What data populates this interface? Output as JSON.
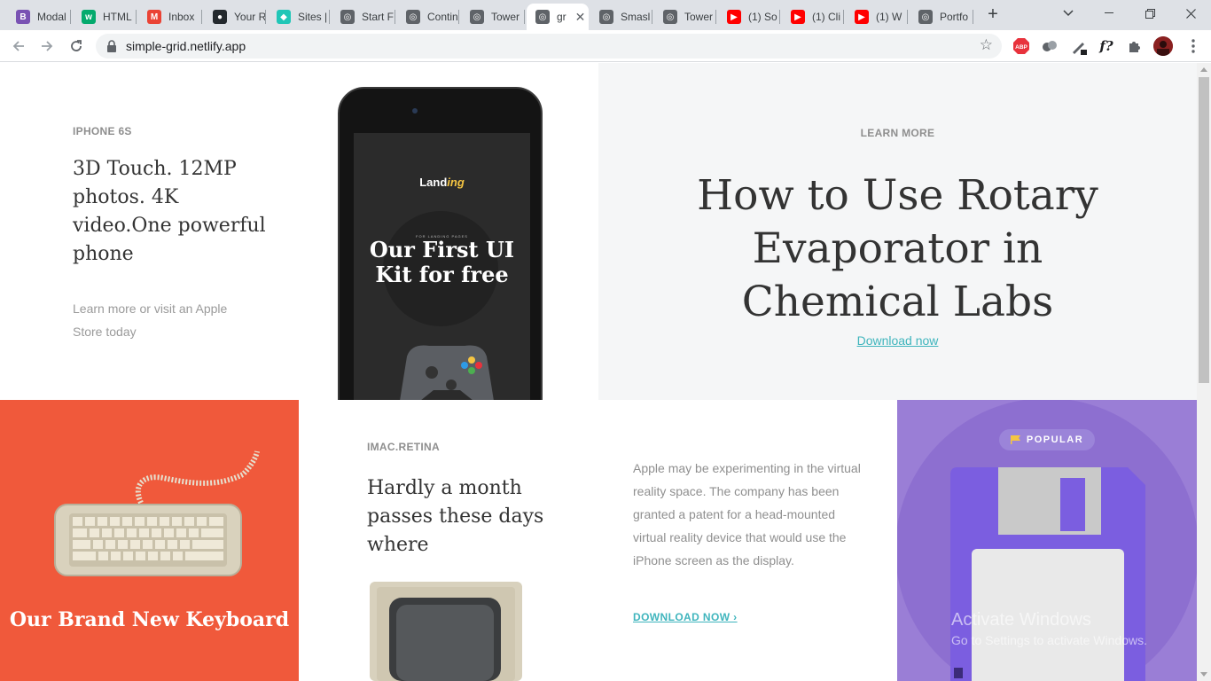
{
  "tabs": [
    {
      "label": "Modal",
      "icon": "bootstrap-icon",
      "color": "#7952b3",
      "glyph": "B"
    },
    {
      "label": "HTML",
      "icon": "w3schools-icon",
      "color": "#04aa6d",
      "glyph": "w"
    },
    {
      "label": "Inbox",
      "icon": "gmail-icon",
      "color": "#ea4335",
      "glyph": "M"
    },
    {
      "label": "Your R",
      "icon": "github-icon",
      "color": "#24292e",
      "glyph": "●"
    },
    {
      "label": "Sites |",
      "icon": "netlify-icon",
      "color": "#20c6b7",
      "glyph": "◆"
    },
    {
      "label": "Start F",
      "icon": "globe-icon",
      "color": "#5f6368",
      "glyph": "◎"
    },
    {
      "label": "Contin",
      "icon": "globe-icon",
      "color": "#5f6368",
      "glyph": "◎"
    },
    {
      "label": "Tower",
      "icon": "globe-icon",
      "color": "#5f6368",
      "glyph": "◎"
    },
    {
      "label": "gr",
      "icon": "globe-icon",
      "color": "#5f6368",
      "glyph": "◎",
      "active": true
    },
    {
      "label": "Smasl",
      "icon": "globe-icon",
      "color": "#5f6368",
      "glyph": "◎"
    },
    {
      "label": "Tower",
      "icon": "globe-icon",
      "color": "#5f6368",
      "glyph": "◎"
    },
    {
      "label": "(1) So",
      "icon": "youtube-icon",
      "color": "#ff0000",
      "glyph": "▶"
    },
    {
      "label": "(1) Cli",
      "icon": "youtube-icon",
      "color": "#ff0000",
      "glyph": "▶"
    },
    {
      "label": "(1) W",
      "icon": "youtube-icon",
      "color": "#ff0000",
      "glyph": "▶"
    },
    {
      "label": "Portfo",
      "icon": "globe-icon",
      "color": "#5f6368",
      "glyph": "◎"
    }
  ],
  "browser": {
    "url": "simple-grid.netlify.app",
    "extensions": [
      "adblock-icon",
      "extension-icon",
      "pen-icon",
      "font-icon",
      "puzzle-icon",
      "profile-avatar"
    ],
    "abp_label": "ABP",
    "font_ext_label": "f?"
  },
  "iphone": {
    "eyebrow": "IPHONE 6S",
    "headline": "3D Touch. 12MP photos. 4K video.One powerful phone",
    "sub": "Learn more or visit an Apple Store today",
    "screen_brand_a": "Land",
    "screen_brand_b": "ing",
    "screen_tiny": "FOR LANDING PAGES",
    "screen_promo": "Our First UI Kit for free"
  },
  "learn": {
    "eyebrow": "LEARN MORE",
    "title": "How to Use Rotary Evaporator in Chemical Labs",
    "link": "Download now"
  },
  "keyboard": {
    "title": "Our Brand New Keyboard",
    "color": "#f0593b"
  },
  "imac": {
    "eyebrow": "IMAC.RETINA",
    "headline": "Hardly a month passes these days where",
    "body": "Apple may be experimenting in the virtual reality space. The company has been granted a patent for a head-mounted virtual reality device that would use the iPhone screen as the display.",
    "cta": "DOWNLOAD NOW ›"
  },
  "floppy": {
    "badge": "POPULAR",
    "color": "#9a7ed6"
  },
  "watermark": {
    "line1": "Activate Windows",
    "line2": "Go to Settings to activate Windows."
  },
  "colors": {
    "accent": "#3fb5bd",
    "text_dark": "#333333",
    "text_muted": "#8e8e8e"
  }
}
